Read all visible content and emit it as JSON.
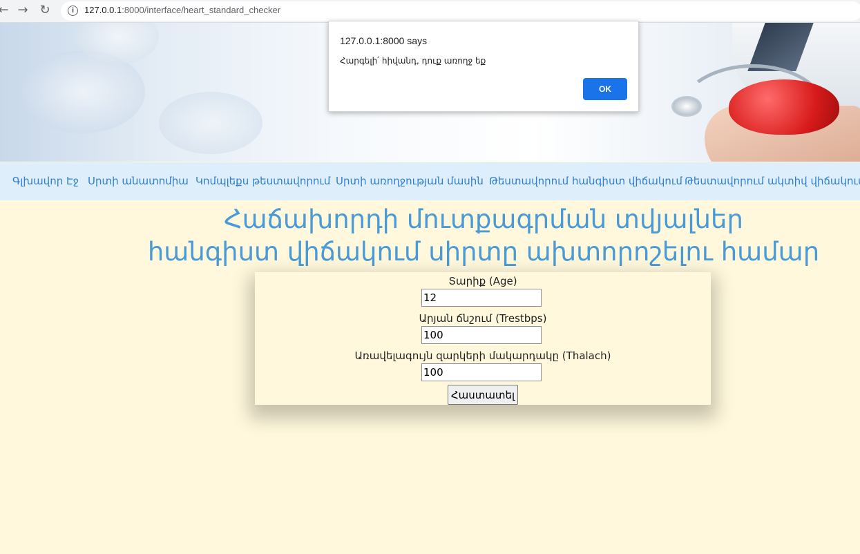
{
  "browser": {
    "url_host": "127.0.0.1",
    "url_rest": ":8000/interface/heart_standard_checker"
  },
  "menu": {
    "items": [
      "Գլխավոր Էջ",
      "Սրտի անատոմիա",
      "Կոմպլեքս թեստավորում",
      "Սրտի առողջության մասին",
      "Թեստավորում հանգիստ վիճակում",
      "Թեստավորում ակտիվ վիճակում"
    ]
  },
  "heading": {
    "line1": "Հաճախորդի մուտքագրման տվյալներ",
    "line2": "հանգիստ վիճակում սիրտը ախտորոշելու համար"
  },
  "form": {
    "age_label": "Տարիք (Age)",
    "age_value": "12",
    "trestbps_label": "Արյան ճնշում (Trestbps)",
    "trestbps_value": "100",
    "thalach_label": "Առավելագույն զարկերի մակարդակը (Thalach)",
    "thalach_value": "100",
    "submit_label": "Հաստատել"
  },
  "dialog": {
    "title": "127.0.0.1:8000 says",
    "message": "Հարգելի՛ հիվանդ, դուք առողջ եք",
    "ok_label": "OK"
  },
  "colors": {
    "page_bg": "#fff8dc",
    "menu_bg": "#deeefb",
    "menu_link": "#2f7fd3",
    "heading": "#4a9ad6",
    "ok_button": "#1a73e8"
  }
}
